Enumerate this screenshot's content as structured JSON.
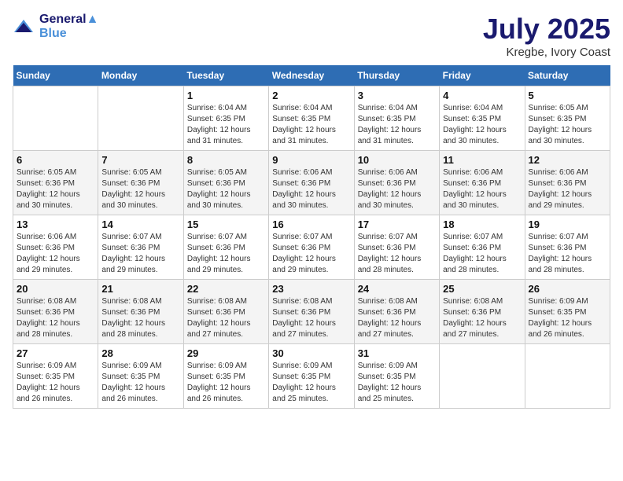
{
  "header": {
    "logo_line1": "General",
    "logo_line2": "Blue",
    "month": "July 2025",
    "location": "Kregbe, Ivory Coast"
  },
  "weekdays": [
    "Sunday",
    "Monday",
    "Tuesday",
    "Wednesday",
    "Thursday",
    "Friday",
    "Saturday"
  ],
  "weeks": [
    [
      {
        "day": "",
        "sunrise": "",
        "sunset": "",
        "daylight": ""
      },
      {
        "day": "",
        "sunrise": "",
        "sunset": "",
        "daylight": ""
      },
      {
        "day": "1",
        "sunrise": "Sunrise: 6:04 AM",
        "sunset": "Sunset: 6:35 PM",
        "daylight": "Daylight: 12 hours and 31 minutes."
      },
      {
        "day": "2",
        "sunrise": "Sunrise: 6:04 AM",
        "sunset": "Sunset: 6:35 PM",
        "daylight": "Daylight: 12 hours and 31 minutes."
      },
      {
        "day": "3",
        "sunrise": "Sunrise: 6:04 AM",
        "sunset": "Sunset: 6:35 PM",
        "daylight": "Daylight: 12 hours and 31 minutes."
      },
      {
        "day": "4",
        "sunrise": "Sunrise: 6:04 AM",
        "sunset": "Sunset: 6:35 PM",
        "daylight": "Daylight: 12 hours and 30 minutes."
      },
      {
        "day": "5",
        "sunrise": "Sunrise: 6:05 AM",
        "sunset": "Sunset: 6:35 PM",
        "daylight": "Daylight: 12 hours and 30 minutes."
      }
    ],
    [
      {
        "day": "6",
        "sunrise": "Sunrise: 6:05 AM",
        "sunset": "Sunset: 6:36 PM",
        "daylight": "Daylight: 12 hours and 30 minutes."
      },
      {
        "day": "7",
        "sunrise": "Sunrise: 6:05 AM",
        "sunset": "Sunset: 6:36 PM",
        "daylight": "Daylight: 12 hours and 30 minutes."
      },
      {
        "day": "8",
        "sunrise": "Sunrise: 6:05 AM",
        "sunset": "Sunset: 6:36 PM",
        "daylight": "Daylight: 12 hours and 30 minutes."
      },
      {
        "day": "9",
        "sunrise": "Sunrise: 6:06 AM",
        "sunset": "Sunset: 6:36 PM",
        "daylight": "Daylight: 12 hours and 30 minutes."
      },
      {
        "day": "10",
        "sunrise": "Sunrise: 6:06 AM",
        "sunset": "Sunset: 6:36 PM",
        "daylight": "Daylight: 12 hours and 30 minutes."
      },
      {
        "day": "11",
        "sunrise": "Sunrise: 6:06 AM",
        "sunset": "Sunset: 6:36 PM",
        "daylight": "Daylight: 12 hours and 30 minutes."
      },
      {
        "day": "12",
        "sunrise": "Sunrise: 6:06 AM",
        "sunset": "Sunset: 6:36 PM",
        "daylight": "Daylight: 12 hours and 29 minutes."
      }
    ],
    [
      {
        "day": "13",
        "sunrise": "Sunrise: 6:06 AM",
        "sunset": "Sunset: 6:36 PM",
        "daylight": "Daylight: 12 hours and 29 minutes."
      },
      {
        "day": "14",
        "sunrise": "Sunrise: 6:07 AM",
        "sunset": "Sunset: 6:36 PM",
        "daylight": "Daylight: 12 hours and 29 minutes."
      },
      {
        "day": "15",
        "sunrise": "Sunrise: 6:07 AM",
        "sunset": "Sunset: 6:36 PM",
        "daylight": "Daylight: 12 hours and 29 minutes."
      },
      {
        "day": "16",
        "sunrise": "Sunrise: 6:07 AM",
        "sunset": "Sunset: 6:36 PM",
        "daylight": "Daylight: 12 hours and 29 minutes."
      },
      {
        "day": "17",
        "sunrise": "Sunrise: 6:07 AM",
        "sunset": "Sunset: 6:36 PM",
        "daylight": "Daylight: 12 hours and 28 minutes."
      },
      {
        "day": "18",
        "sunrise": "Sunrise: 6:07 AM",
        "sunset": "Sunset: 6:36 PM",
        "daylight": "Daylight: 12 hours and 28 minutes."
      },
      {
        "day": "19",
        "sunrise": "Sunrise: 6:07 AM",
        "sunset": "Sunset: 6:36 PM",
        "daylight": "Daylight: 12 hours and 28 minutes."
      }
    ],
    [
      {
        "day": "20",
        "sunrise": "Sunrise: 6:08 AM",
        "sunset": "Sunset: 6:36 PM",
        "daylight": "Daylight: 12 hours and 28 minutes."
      },
      {
        "day": "21",
        "sunrise": "Sunrise: 6:08 AM",
        "sunset": "Sunset: 6:36 PM",
        "daylight": "Daylight: 12 hours and 28 minutes."
      },
      {
        "day": "22",
        "sunrise": "Sunrise: 6:08 AM",
        "sunset": "Sunset: 6:36 PM",
        "daylight": "Daylight: 12 hours and 27 minutes."
      },
      {
        "day": "23",
        "sunrise": "Sunrise: 6:08 AM",
        "sunset": "Sunset: 6:36 PM",
        "daylight": "Daylight: 12 hours and 27 minutes."
      },
      {
        "day": "24",
        "sunrise": "Sunrise: 6:08 AM",
        "sunset": "Sunset: 6:36 PM",
        "daylight": "Daylight: 12 hours and 27 minutes."
      },
      {
        "day": "25",
        "sunrise": "Sunrise: 6:08 AM",
        "sunset": "Sunset: 6:36 PM",
        "daylight": "Daylight: 12 hours and 27 minutes."
      },
      {
        "day": "26",
        "sunrise": "Sunrise: 6:09 AM",
        "sunset": "Sunset: 6:35 PM",
        "daylight": "Daylight: 12 hours and 26 minutes."
      }
    ],
    [
      {
        "day": "27",
        "sunrise": "Sunrise: 6:09 AM",
        "sunset": "Sunset: 6:35 PM",
        "daylight": "Daylight: 12 hours and 26 minutes."
      },
      {
        "day": "28",
        "sunrise": "Sunrise: 6:09 AM",
        "sunset": "Sunset: 6:35 PM",
        "daylight": "Daylight: 12 hours and 26 minutes."
      },
      {
        "day": "29",
        "sunrise": "Sunrise: 6:09 AM",
        "sunset": "Sunset: 6:35 PM",
        "daylight": "Daylight: 12 hours and 26 minutes."
      },
      {
        "day": "30",
        "sunrise": "Sunrise: 6:09 AM",
        "sunset": "Sunset: 6:35 PM",
        "daylight": "Daylight: 12 hours and 25 minutes."
      },
      {
        "day": "31",
        "sunrise": "Sunrise: 6:09 AM",
        "sunset": "Sunset: 6:35 PM",
        "daylight": "Daylight: 12 hours and 25 minutes."
      },
      {
        "day": "",
        "sunrise": "",
        "sunset": "",
        "daylight": ""
      },
      {
        "day": "",
        "sunrise": "",
        "sunset": "",
        "daylight": ""
      }
    ]
  ]
}
